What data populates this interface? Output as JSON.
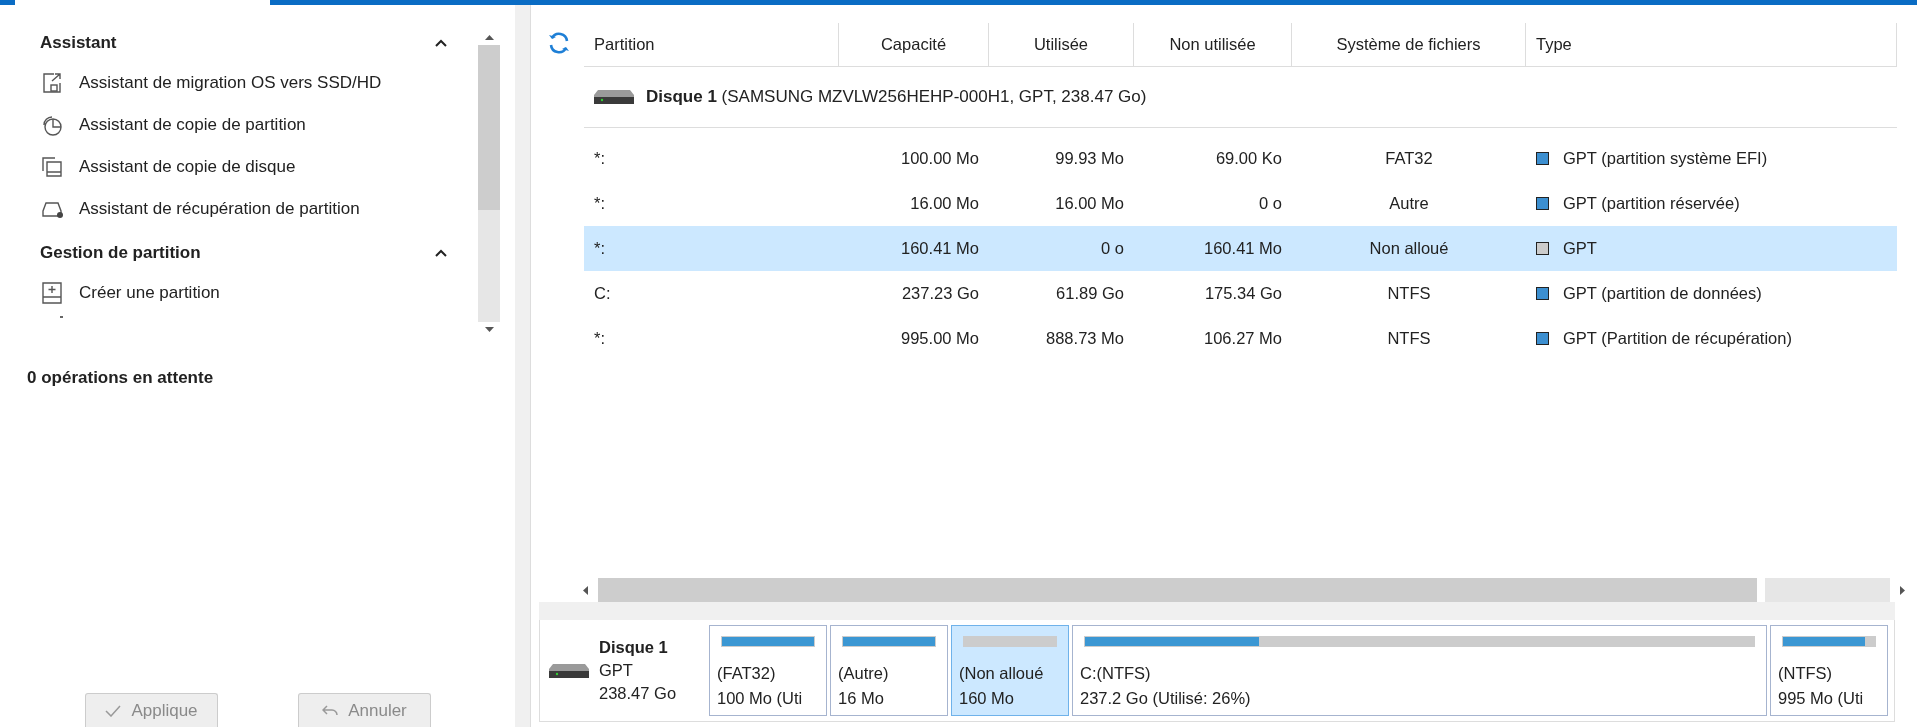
{
  "sidebar": {
    "sections": [
      {
        "title": "Assistant",
        "expanded": true,
        "items": [
          {
            "label": "Assistant de migration OS vers SSD/HD"
          },
          {
            "label": "Assistant de copie de partition"
          },
          {
            "label": "Assistant de copie de disque"
          },
          {
            "label": "Assistant de récupération de partition"
          }
        ]
      },
      {
        "title": "Gestion de partition",
        "expanded": true,
        "items": [
          {
            "label": "Créer une partition"
          }
        ]
      }
    ],
    "pending": "0 opérations en attente",
    "buttons": [
      {
        "label": "Applique",
        "disabled": true
      },
      {
        "label": "Annuler",
        "disabled": true
      }
    ]
  },
  "table": {
    "columns": [
      "Partition",
      "Capacité",
      "Utilisée",
      "Non utilisée",
      "Système de fichiers",
      "Type"
    ],
    "disk": {
      "name": "Disque 1",
      "details": "(SAMSUNG MZVLW256HEHP-000H1, GPT, 238.47 Go)"
    },
    "rows": [
      {
        "partition": "*:",
        "capacity": "100.00 Mo",
        "used": "99.93 Mo",
        "unused": "69.00 Ko",
        "fs": "FAT32",
        "type": "GPT (partition système EFI)",
        "color": "#3c8fd0",
        "selected": false
      },
      {
        "partition": "*:",
        "capacity": "16.00 Mo",
        "used": "16.00 Mo",
        "unused": "0 o",
        "fs": "Autre",
        "type": "GPT (partition réservée)",
        "color": "#3c8fd0",
        "selected": false
      },
      {
        "partition": "*:",
        "capacity": "160.41 Mo",
        "used": "0 o",
        "unused": "160.41 Mo",
        "fs": "Non alloué",
        "type": "GPT",
        "color": "#cccccc",
        "selected": true
      },
      {
        "partition": "C:",
        "capacity": "237.23 Go",
        "used": "61.89 Go",
        "unused": "175.34 Go",
        "fs": "NTFS",
        "type": "GPT (partition de données)",
        "color": "#3c8fd0",
        "selected": false
      },
      {
        "partition": "*:",
        "capacity": "995.00 Mo",
        "used": "888.73 Mo",
        "unused": "106.27 Mo",
        "fs": "NTFS",
        "type": "GPT (Partition de récupération)",
        "color": "#3c8fd0",
        "selected": false
      }
    ]
  },
  "disk_map": {
    "name": "Disque 1",
    "style": "GPT",
    "size": "238.47 Go",
    "partitions": [
      {
        "kind": "allocated",
        "line1": "(FAT32)",
        "line2": "100 Mo (Uti",
        "level": 0.999,
        "selected": false
      },
      {
        "kind": "allocated",
        "line1": "(Autre)",
        "line2": "16 Mo",
        "level": 1,
        "selected": false
      },
      {
        "kind": "unallocated",
        "line1": "(Non alloué",
        "line2": "160 Mo",
        "selected": true
      },
      {
        "kind": "allocated",
        "line1": "C:(NTFS)",
        "line2": "237.2 Go (Utilisé: 26%)",
        "level": 0.26,
        "selected": false
      },
      {
        "kind": "allocated",
        "line1": "(NTFS)",
        "line2": "995 Mo (Uti",
        "level": 0.89,
        "selected": false
      }
    ]
  }
}
